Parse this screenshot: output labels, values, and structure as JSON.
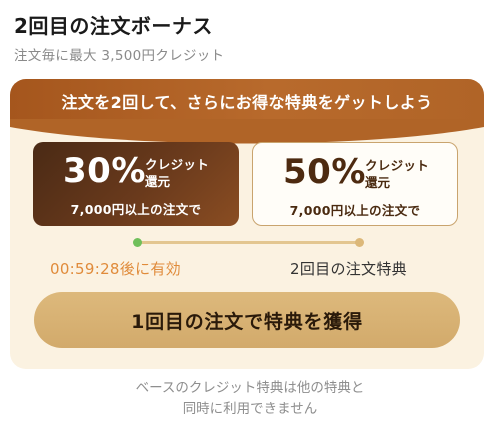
{
  "header": {
    "title": "2回目の注文ボーナス",
    "subtitle": "注文毎に最大 3,500円クレジット"
  },
  "banner": {
    "text": "注文を2回して、さらにお得な特典をゲットしよう"
  },
  "tiers": [
    {
      "percent": "30%",
      "credit": "クレジット",
      "return": "還元",
      "condition": "7,000円以上の注文で"
    },
    {
      "percent": "50%",
      "credit": "クレジット",
      "return": "還元",
      "condition": "7,000円以上の注文で"
    }
  ],
  "progress": {
    "timer": "00:59:28後に有効",
    "second_label": "2回目の注文特典"
  },
  "cta": {
    "label": "1回目の注文で特典を獲得"
  },
  "note": {
    "line1": "ベースのクレジット特典は他の特典と",
    "line2": "同時に利用できません"
  },
  "colors": {
    "banner": "#b06427",
    "card_bg": "#fbf2e1",
    "active_tier": "#5a3219",
    "timer": "#e08b3a",
    "cta": "#d8b474",
    "progress_dot_active": "#6fbf5a"
  },
  "icons": []
}
